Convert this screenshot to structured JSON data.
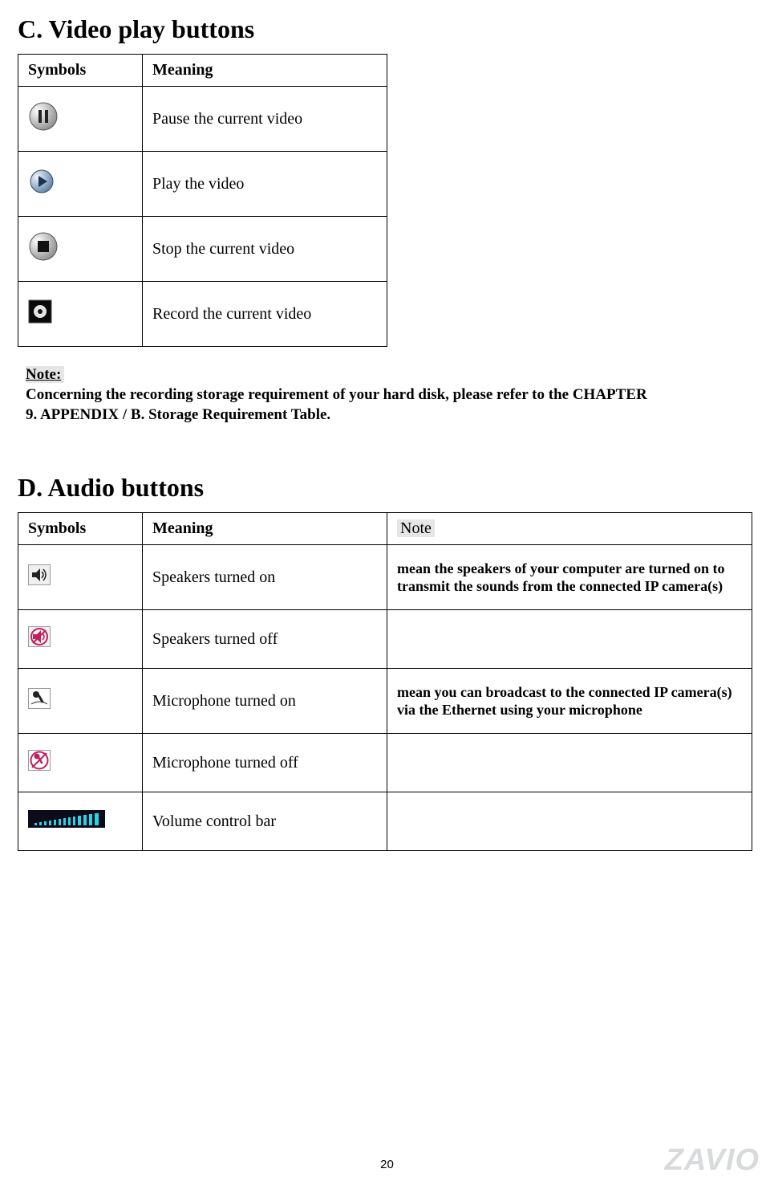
{
  "section_c": {
    "title": "C. Video play buttons",
    "headers": {
      "symbols": "Symbols",
      "meaning": "Meaning"
    },
    "rows": [
      {
        "icon": "pause",
        "meaning": "Pause the current video"
      },
      {
        "icon": "play",
        "meaning": "Play the video"
      },
      {
        "icon": "stop",
        "meaning": "Stop the current video"
      },
      {
        "icon": "record",
        "meaning": "Record the current video"
      }
    ],
    "note_label": "Note:",
    "note_text": "Concerning the recording storage requirement of your hard disk, please refer to the CHAPTER 9. APPENDIX / B. Storage Requirement Table."
  },
  "section_d": {
    "title": "D. Audio buttons",
    "headers": {
      "symbols": "Symbols",
      "meaning": "Meaning",
      "note": "Note"
    },
    "rows": [
      {
        "icon": "speaker_on",
        "meaning": "Speakers turned on",
        "note": "mean the speakers of your computer are turned on to transmit the sounds from the connected IP camera(s)"
      },
      {
        "icon": "speaker_off",
        "meaning": "Speakers turned off",
        "note": ""
      },
      {
        "icon": "mic_on",
        "meaning": "Microphone turned on",
        "note": "mean you can broadcast to the connected IP camera(s) via the Ethernet using your microphone"
      },
      {
        "icon": "mic_off",
        "meaning": "Microphone turned off",
        "note": ""
      },
      {
        "icon": "volume",
        "meaning": "Volume control bar",
        "note": ""
      }
    ]
  },
  "page_number": "20",
  "logo": "ZAVIO"
}
